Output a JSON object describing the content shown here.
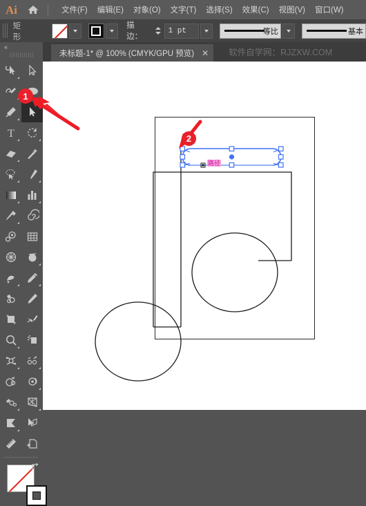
{
  "app": {
    "logo_text": "Ai",
    "home_icon": "home-icon"
  },
  "menubar": {
    "items": [
      {
        "label": "文件(F)",
        "name": "menu-file"
      },
      {
        "label": "编辑(E)",
        "name": "menu-edit"
      },
      {
        "label": "对象(O)",
        "name": "menu-object"
      },
      {
        "label": "文字(T)",
        "name": "menu-type"
      },
      {
        "label": "选择(S)",
        "name": "menu-select"
      },
      {
        "label": "效果(C)",
        "name": "menu-effect"
      },
      {
        "label": "视图(V)",
        "name": "menu-view"
      },
      {
        "label": "窗口(W)",
        "name": "menu-window"
      }
    ]
  },
  "controlbar": {
    "context_label": "矩形",
    "fill_swatch": "none-fill-swatch",
    "stroke_swatch": "black-stroke-swatch",
    "stroke_label": "描边：",
    "stroke_weight": "1 pt",
    "variable_width_profile": "等比",
    "brush_definition": "基本"
  },
  "tabbar": {
    "tabs": [
      {
        "title": "未标题-1* @ 100% (CMYK/GPU 预览)",
        "close": "✕"
      }
    ],
    "watermark": "软件自学网：RJZXW.COM"
  },
  "toolbar": {
    "collapse": "«",
    "tools": [
      {
        "name": "tool-shaper",
        "label": "Shaper"
      },
      {
        "name": "tool-selection",
        "label": "选择工具"
      },
      {
        "name": "tool-direct-selection",
        "label": "直接选择工具"
      },
      {
        "name": "tool-ellipse",
        "label": "椭圆工具"
      },
      {
        "name": "tool-paintbrush",
        "label": "画笔工具"
      },
      {
        "name": "tool-magic-wand",
        "label": "魔棒工具"
      },
      {
        "name": "tool-type",
        "label": "文字工具"
      },
      {
        "name": "tool-rotate",
        "label": "旋转工具"
      },
      {
        "name": "tool-eraser",
        "label": "橡皮擦工具"
      },
      {
        "name": "tool-wand-sparkle",
        "label": "自由变换"
      },
      {
        "name": "tool-lasso",
        "label": "套索工具"
      },
      {
        "name": "tool-pen",
        "label": "钢笔工具"
      },
      {
        "name": "tool-gradient",
        "label": "渐变工具"
      },
      {
        "name": "tool-column-graph",
        "label": "柱形图工具"
      },
      {
        "name": "tool-eyedropper",
        "label": "吸管工具"
      },
      {
        "name": "tool-spiral",
        "label": "螺旋线工具"
      },
      {
        "name": "tool-blob-brush",
        "label": "斑点画笔工具"
      },
      {
        "name": "tool-perspective-grid",
        "label": "透视网格工具"
      },
      {
        "name": "tool-mesh",
        "label": "网格工具"
      },
      {
        "name": "tool-shape-builder",
        "label": "形状生成器"
      },
      {
        "name": "tool-symbol-sprayer",
        "label": "符号喷枪工具"
      },
      {
        "name": "tool-paintbrush-2",
        "label": "斑点画笔"
      },
      {
        "name": "tool-shape-builder-2",
        "label": "形状生成器工具"
      },
      {
        "name": "tool-pencil",
        "label": "铅笔工具"
      },
      {
        "name": "tool-artboard",
        "label": "画板工具"
      },
      {
        "name": "tool-slice",
        "label": "切片工具"
      },
      {
        "name": "tool-zoom",
        "label": "缩放工具"
      },
      {
        "name": "tool-print-tiling",
        "label": "打印拼贴"
      },
      {
        "name": "tool-rotate-twirl",
        "label": "旋转扭曲"
      },
      {
        "name": "tool-scale-shear",
        "label": "比例缩放"
      },
      {
        "name": "tool-blend",
        "label": "混合工具"
      },
      {
        "name": "tool-reshape",
        "label": "整形工具"
      },
      {
        "name": "tool-warp",
        "label": "变形工具"
      },
      {
        "name": "tool-perspective",
        "label": "透视选区"
      },
      {
        "name": "tool-gradient-mesh",
        "label": "网格渐变"
      },
      {
        "name": "tool-free-transform",
        "label": "自由变换工具"
      },
      {
        "name": "tool-measure",
        "label": "度量工具"
      },
      {
        "name": "tool-artboard-2",
        "label": "画板"
      }
    ],
    "fill_color": "#ffffff",
    "fill_is_none": true,
    "stroke_color": "#000000"
  },
  "canvas": {
    "selection_color": "#3f72f5",
    "selection_label": "路径",
    "zoom": "100%"
  },
  "annotations": [
    {
      "name": "step-badge-1",
      "number": "1",
      "arrow_color": "#e8212a"
    },
    {
      "name": "step-badge-2",
      "number": "2",
      "arrow_color": "#e8212a"
    }
  ]
}
